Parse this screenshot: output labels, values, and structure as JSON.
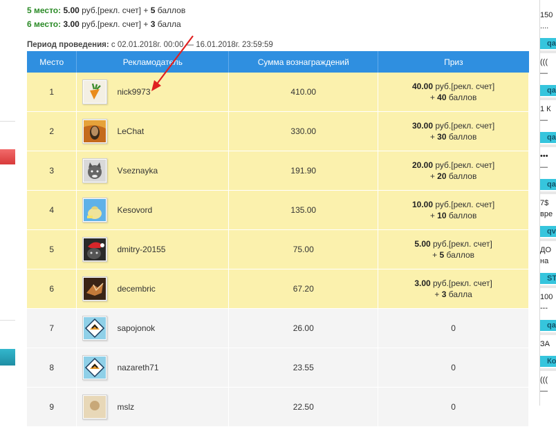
{
  "places": [
    {
      "label": "5 место:",
      "amount": "5.00",
      "unit": "руб.[рекл. счет] +",
      "bonus": "5",
      "bonus_word": "баллов"
    },
    {
      "label": "6 место:",
      "amount": "3.00",
      "unit": "руб.[рекл. счет] +",
      "bonus": "3",
      "bonus_word": "балла"
    }
  ],
  "period": {
    "label": "Период проведения:",
    "value": "с 02.01.2018г. 00:00 — 16.01.2018г. 23:59:59"
  },
  "table": {
    "headers": [
      "Место",
      "Рекламодатель",
      "Сумма вознаграждений",
      "Приз"
    ],
    "rows": [
      {
        "place": "1",
        "name": "nick9973",
        "sum": "410.00",
        "prize_amount": "40.00",
        "prize_unit": "руб.[рекл. счет]",
        "prize_bonus": "40",
        "prize_bonus_word": "баллов",
        "avatar": "carrot-avatar"
      },
      {
        "place": "2",
        "name": "LeChat",
        "sum": "330.00",
        "prize_amount": "30.00",
        "prize_unit": "руб.[рекл. счет]",
        "prize_bonus": "30",
        "prize_bonus_word": "баллов",
        "avatar": "scream-avatar"
      },
      {
        "place": "3",
        "name": "Vseznayka",
        "sum": "191.90",
        "prize_amount": "20.00",
        "prize_unit": "руб.[рекл. счет]",
        "prize_bonus": "20",
        "prize_bonus_word": "баллов",
        "avatar": "cat-avatar"
      },
      {
        "place": "4",
        "name": "Kesovord",
        "sum": "135.00",
        "prize_amount": "10.00",
        "prize_unit": "руб.[рекл. счет]",
        "prize_bonus": "10",
        "prize_bonus_word": "баллов",
        "avatar": "money-bag-avatar"
      },
      {
        "place": "5",
        "name": "dmitry-20155",
        "sum": "75.00",
        "prize_amount": "5.00",
        "prize_unit": "руб.[рекл. счет]",
        "prize_bonus": "5",
        "prize_bonus_word": "баллов",
        "avatar": "santa-cat-avatar"
      },
      {
        "place": "6",
        "name": "decembric",
        "sum": "67.20",
        "prize_amount": "3.00",
        "prize_unit": "руб.[рекл. счет]",
        "prize_bonus": "3",
        "prize_bonus_word": "балла",
        "avatar": "fox-avatar"
      },
      {
        "place": "7",
        "name": "sapojonok",
        "sum": "26.00",
        "prize": "0",
        "avatar": "default-avatar"
      },
      {
        "place": "8",
        "name": "nazareth71",
        "sum": "23.55",
        "prize": "0",
        "avatar": "default-avatar"
      },
      {
        "place": "9",
        "name": "mslz",
        "sum": "22.50",
        "prize": "0",
        "avatar": "photo-avatar"
      }
    ]
  },
  "sidebar": {
    "items": [
      {
        "text": "150",
        "sub": "....",
        "tag": "qa"
      },
      {
        "text": "(((",
        "sub": "—",
        "tag": "qa"
      },
      {
        "text": "1 К",
        "sub": "—",
        "tag": "qa"
      },
      {
        "text": "•••",
        "sub": "—",
        "tag": "qa"
      },
      {
        "text": "7$",
        "sub": "вре",
        "tag": "qv"
      },
      {
        "text": "ДО",
        "sub": "на",
        "tag": "ST"
      },
      {
        "text": "100",
        "sub": "---",
        "tag": "qa"
      },
      {
        "text": "ЗА",
        "sub": "",
        "tag": "Ко"
      },
      {
        "text": "(((",
        "sub": "—",
        "tag": ""
      }
    ]
  },
  "colors": {
    "header_bg": "#2f8fe0",
    "prize_row": "#fbf1ad",
    "plain_row": "#f4f4f4",
    "place_label": "#2a8a26",
    "arrow": "#e02020",
    "sidebar_tag": "#36c5dd"
  }
}
